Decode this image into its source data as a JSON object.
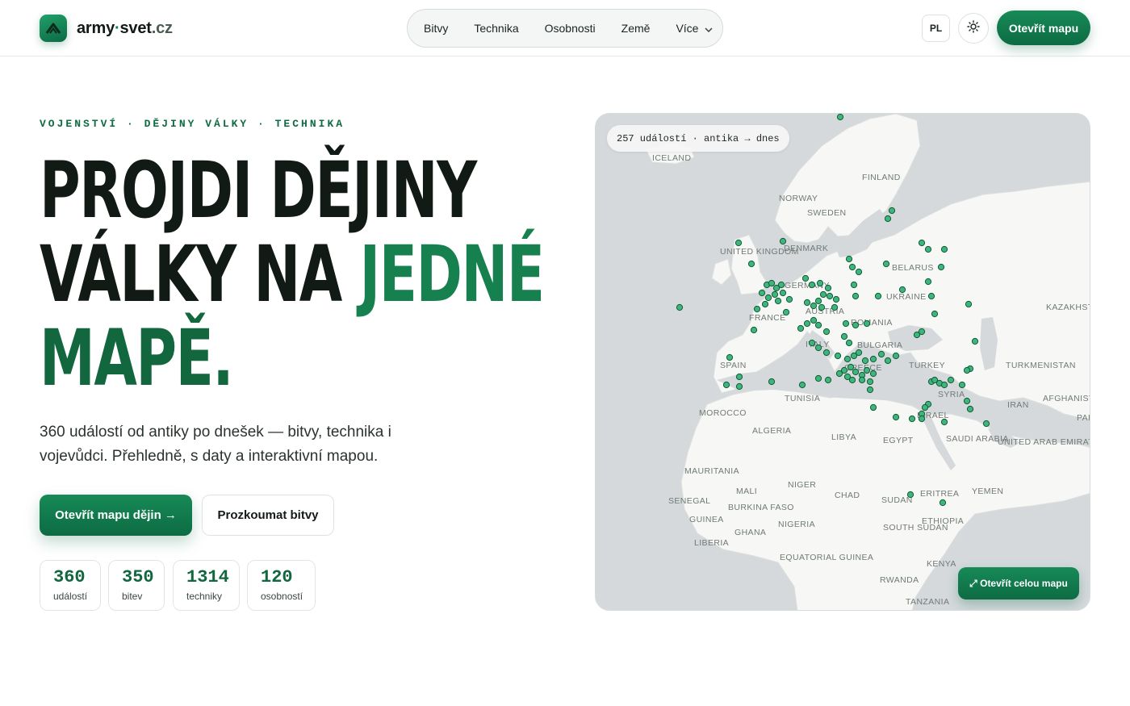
{
  "brand": {
    "name_main": "army",
    "name_dot": "·",
    "name_mid": "svet",
    "name_tld": ".cz"
  },
  "nav": {
    "items": [
      "Bitvy",
      "Technika",
      "Osobnosti",
      "Země",
      "Více"
    ],
    "lang": "PL",
    "open_map": "Otevřít mapu"
  },
  "hero": {
    "eyebrow": "VOJENSTVÍ · DĚJINY VÁLKY · TECHNIKA",
    "line1": "PROJDI DĚJINY",
    "line2_dark": "VÁLKY NA ",
    "line2_green": "JEDNÉ",
    "line3": "MAPĚ.",
    "lede": "360 událostí od antiky po dnešek — bitvy, technika i vojevůdci. Přehledně, s daty a interaktivní mapou.",
    "cta_primary": "Otevřít mapu dějin →",
    "cta_secondary": "Prozkoumat bitvy"
  },
  "stats": [
    {
      "value": "360",
      "label": "událostí"
    },
    {
      "value": "350",
      "label": "bitev"
    },
    {
      "value": "1314",
      "label": "techniky"
    },
    {
      "value": "120",
      "label": "osobností"
    }
  ],
  "map": {
    "pill": "257 událostí · antika → dnes",
    "open_full": "⤢ Otevřít celou mapu",
    "labels": [
      "ICELAND",
      "FINLAND",
      "NORWAY",
      "SWEDEN",
      "DENMARK",
      "UNITED KINGDOM",
      "BELARUS",
      "GERMANY",
      "UKRAINE",
      "KAZAKHSTAN",
      "AUSTRIA",
      "FRANCE",
      "ROMANIA",
      "ITALY",
      "BULGARIA",
      "SPAIN",
      "GREECE",
      "TURKEY",
      "TURKMENISTAN",
      "SYRIA",
      "TUNISIA",
      "AFGHANISTAN",
      "IRAN",
      "MOROCCO",
      "ISRAEL",
      "PAK",
      "ALGERIA",
      "LIBYA",
      "EGYPT",
      "SAUDI ARABIA",
      "UNITED ARAB EMIRATES",
      "MAURITANIA",
      "MALI",
      "NIGER",
      "CHAD",
      "SUDAN",
      "ERITREA",
      "YEMEN",
      "SENEGAL",
      "BURKINA FASO",
      "GUINEA",
      "GHANA",
      "NIGERIA",
      "ETHIOPIA",
      "SOUTH SUDAN",
      "LIBERIA",
      "EQUATORIAL GUINEA",
      "KENYA",
      "RWANDA",
      "TANZANIA"
    ],
    "marker_color": "#3fb57c"
  },
  "colors": {
    "accent": "#12673f",
    "accent_light": "#17804f",
    "ink": "#111a14"
  }
}
